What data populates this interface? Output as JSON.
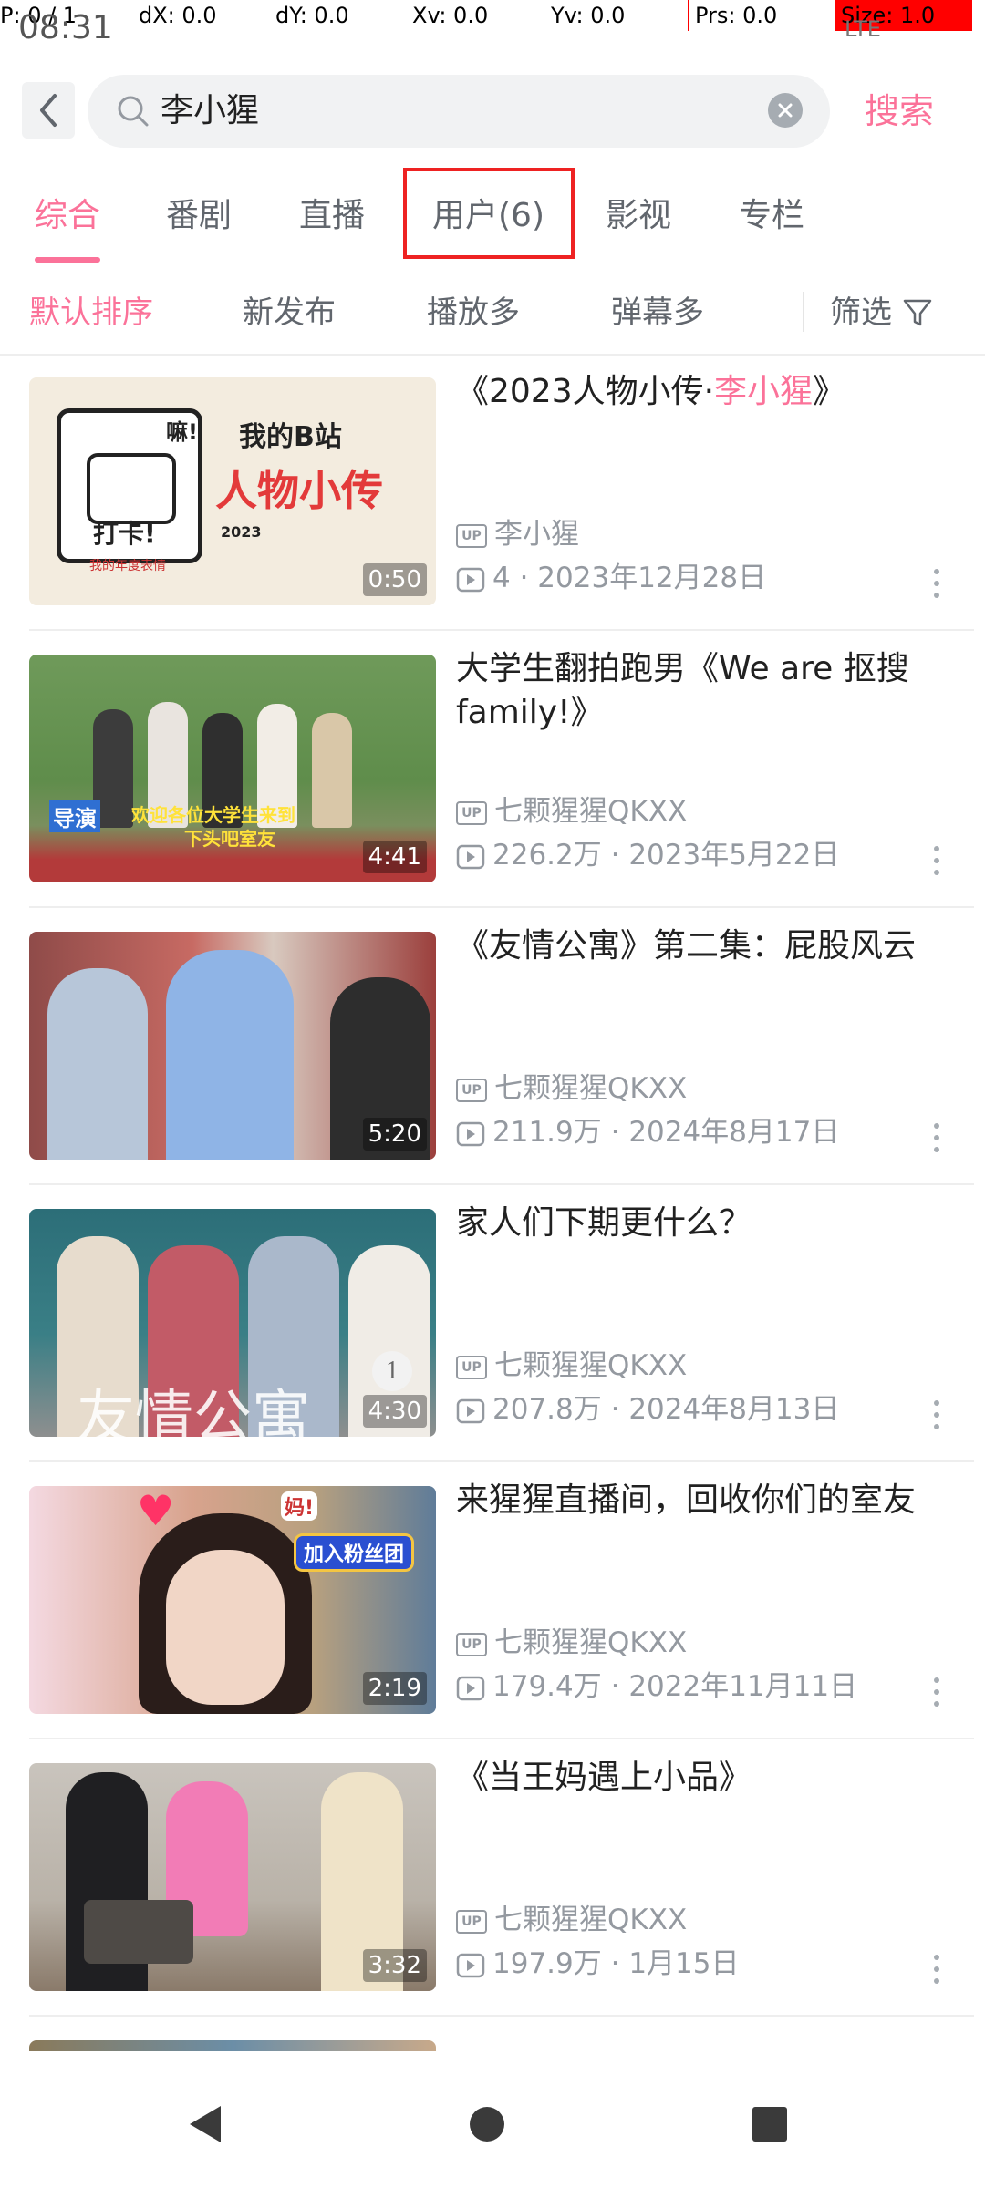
{
  "debug": {
    "p": "P: 0 / 1",
    "dx": "dX: 0.0",
    "dy": "dY: 0.0",
    "xv": "Xv: 0.0",
    "yv": "Yv: 0.0",
    "prs": "Prs: 0.0",
    "size": "Size: 1.0"
  },
  "status": {
    "time": "08:31",
    "network": "LTE"
  },
  "search": {
    "query": "李小猩",
    "submit_label": "搜索"
  },
  "tabs": [
    {
      "label": "综合",
      "active": true
    },
    {
      "label": "番剧"
    },
    {
      "label": "直播"
    },
    {
      "label": "用户(6)"
    },
    {
      "label": "影视"
    },
    {
      "label": "专栏"
    }
  ],
  "filters": {
    "default_sort": "默认排序",
    "newest": "新发布",
    "most_played": "播放多",
    "most_danmaku": "弹幕多",
    "filter": "筛选"
  },
  "videos": [
    {
      "title_pre": "《2023人物小传·",
      "title_hl": "李小猩",
      "title_post": "》",
      "uploader": "李小猩",
      "plays": "4",
      "date": "2023年12月28日",
      "duration": "0:50",
      "thumb_texts": [
        "我的B站",
        "人物小传",
        "嘛!",
        "打卡!",
        "2023",
        "我的年度表情"
      ]
    },
    {
      "title": "大学生翻拍跑男《We are 抠搜family!》",
      "uploader": "七颗猩猩QKXX",
      "plays": "226.2万",
      "date": "2023年5月22日",
      "duration": "4:41",
      "thumb_texts": [
        "导演",
        "欢迎各位大学生来到",
        "下头吧室友"
      ]
    },
    {
      "title": "《友情公寓》第二集：屁股风云",
      "uploader": "七颗猩猩QKXX",
      "plays": "211.9万",
      "date": "2024年8月17日",
      "duration": "5:20"
    },
    {
      "title": "家人们下期更什么？",
      "uploader": "七颗猩猩QKXX",
      "plays": "207.8万",
      "date": "2024年8月13日",
      "duration": "4:30",
      "thumb_texts": [
        "友情公寓"
      ]
    },
    {
      "title": "来猩猩直播间，回收你们的室友",
      "uploader": "七颗猩猩QKXX",
      "plays": "179.4万",
      "date": "2022年11月11日",
      "duration": "2:19",
      "thumb_texts": [
        "加入粉丝团",
        "妈!"
      ]
    },
    {
      "title": "《当王妈遇上小品》",
      "uploader": "七颗猩猩QKXX",
      "plays": "197.9万",
      "date": "1月15日",
      "duration": "3:32"
    }
  ],
  "colors": {
    "accent": "#fb7299",
    "highlight_box": "#ee2222",
    "text_primary": "#212121",
    "text_secondary": "#9499a0"
  }
}
